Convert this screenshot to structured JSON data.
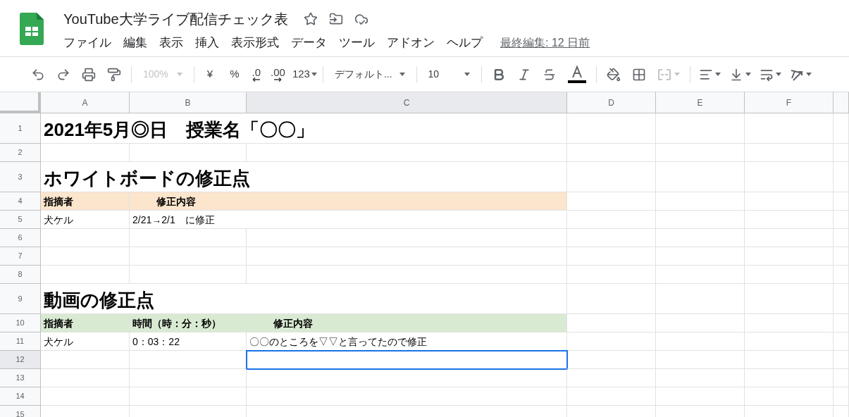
{
  "document": {
    "title": "YouTube大学ライブ配信チェック表",
    "last_edit": "最終編集: 12 日前"
  },
  "menu": [
    "ファイル",
    "編集",
    "表示",
    "挿入",
    "表示形式",
    "データ",
    "ツール",
    "アドオン",
    "ヘルプ"
  ],
  "toolbar": {
    "zoom": {
      "value": "100%",
      "disabled": true
    },
    "currency": "¥",
    "percent": "%",
    "decrease_decimal": ".0",
    "increase_decimal": ".00",
    "number_format": "123",
    "font": "デフォルト...",
    "font_size": "10",
    "merge_disabled": true
  },
  "columns": [
    {
      "label": "A",
      "selected": false
    },
    {
      "label": "B",
      "selected": false
    },
    {
      "label": "C",
      "selected": true
    },
    {
      "label": "D",
      "selected": false
    },
    {
      "label": "E",
      "selected": false
    },
    {
      "label": "F",
      "selected": false
    }
  ],
  "rows": [
    {
      "number": "1",
      "kind": "title",
      "selected": false,
      "A": {
        "text": "2021年5月◎日　授業名「〇〇」"
      }
    },
    {
      "number": "2",
      "kind": "blank",
      "selected": false
    },
    {
      "number": "3",
      "kind": "title",
      "selected": false,
      "A": {
        "text": "ホワイトボードの修正点"
      }
    },
    {
      "number": "4",
      "kind": "header",
      "selected": false,
      "color": "#fce5cd",
      "A": {
        "text": "指摘者",
        "indent": false
      },
      "B": {
        "text": "修正内容",
        "indent": true
      }
    },
    {
      "number": "5",
      "kind": "data",
      "selected": false,
      "A": {
        "text": "犬ケル"
      },
      "B": {
        "text": "2/21→2/1　に修正"
      }
    },
    {
      "number": "6",
      "kind": "blank",
      "selected": false
    },
    {
      "number": "7",
      "kind": "blank",
      "selected": false
    },
    {
      "number": "8",
      "kind": "blank",
      "selected": false
    },
    {
      "number": "9",
      "kind": "title",
      "selected": false,
      "A": {
        "text": "動画の修正点"
      }
    },
    {
      "number": "10",
      "kind": "header",
      "selected": false,
      "color": "#d9ead3",
      "A": {
        "text": "指摘者",
        "indent": false
      },
      "B": {
        "text": "時間（時：分：秒）",
        "indent": false
      },
      "C": {
        "text": "修正内容",
        "indent": true
      }
    },
    {
      "number": "11",
      "kind": "data",
      "selected": false,
      "A": {
        "text": "犬ケル"
      },
      "B": {
        "text": "0：03：22"
      },
      "C": {
        "text": "〇〇のところを▽▽と言ってたので修正"
      }
    },
    {
      "number": "12",
      "kind": "blank",
      "selected": true
    },
    {
      "number": "13",
      "kind": "blank",
      "selected": false
    },
    {
      "number": "14",
      "kind": "blank",
      "selected": false
    },
    {
      "number": "15",
      "kind": "blank",
      "selected": false
    }
  ]
}
